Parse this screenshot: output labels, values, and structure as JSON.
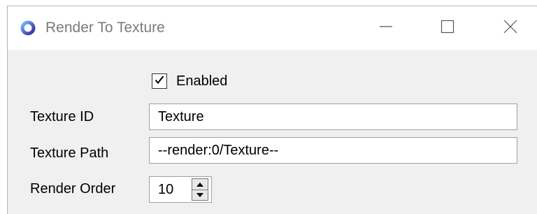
{
  "window": {
    "title": "Render To Texture",
    "controls": {
      "minimize_icon": "minimize-icon",
      "maximize_icon": "maximize-icon",
      "close_icon": "close-icon"
    }
  },
  "form": {
    "enabled": {
      "label": "Enabled",
      "checked": true
    },
    "texture_id": {
      "label": "Texture ID",
      "value": "Texture"
    },
    "texture_path": {
      "label": "Texture Path",
      "value": "--render:0/Texture--"
    },
    "render_order": {
      "label": "Render Order",
      "value": "10"
    }
  },
  "colors": {
    "window_bg": "#f0f0f0",
    "titlebar_bg": "#ffffff",
    "title_text": "#7a7a7a",
    "icon_accent": "#4a3aa8"
  }
}
